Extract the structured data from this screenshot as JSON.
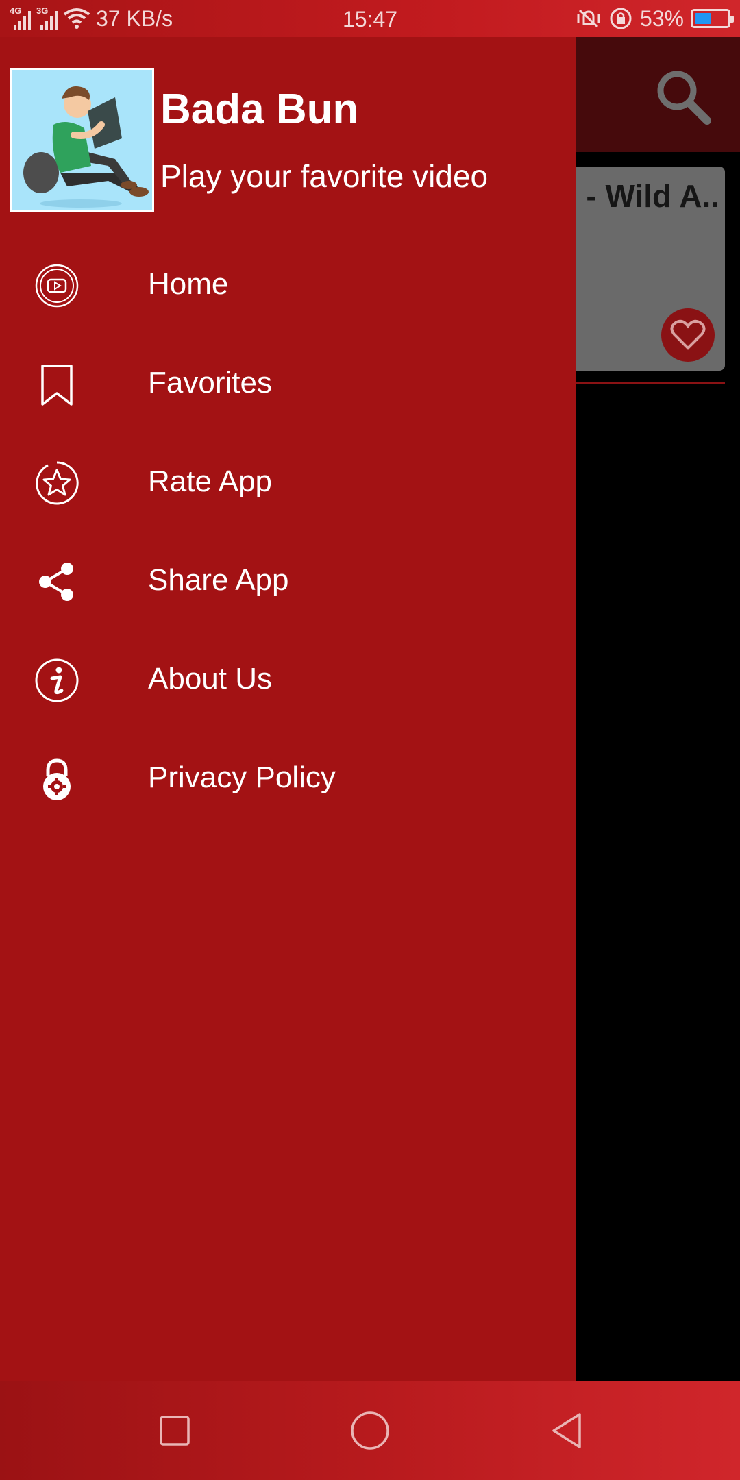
{
  "status_bar": {
    "network_1": "4G",
    "network_2": "3G",
    "speed": "37 KB/s",
    "time": "15:47",
    "battery_percent_text": "53%",
    "battery_level": 0.53
  },
  "background_app": {
    "card_title": "- Wild A..",
    "icons": [
      "search-icon",
      "heart-icon"
    ]
  },
  "drawer": {
    "app_name": "Bada Bun",
    "tagline": "Play your favorite video",
    "items": [
      {
        "label": "Home",
        "icon": "youtube-play-icon"
      },
      {
        "label": "Favorites",
        "icon": "bookmark-icon"
      },
      {
        "label": "Rate App",
        "icon": "star-icon"
      },
      {
        "label": "Share App",
        "icon": "share-icon"
      },
      {
        "label": "About Us",
        "icon": "info-icon"
      },
      {
        "label": "Privacy Policy",
        "icon": "lock-icon"
      }
    ]
  },
  "nav_bar": {
    "buttons": [
      "recents-square-icon",
      "home-circle-icon",
      "back-triangle-icon"
    ]
  },
  "colors": {
    "drawer_bg": "#a31214",
    "accent": "#c21b1f",
    "card_bg": "#6a6a6a"
  }
}
